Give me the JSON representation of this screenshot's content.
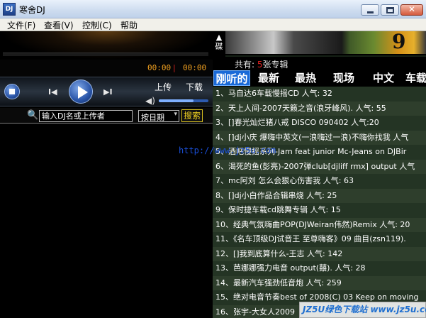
{
  "window": {
    "title": "寒舍DJ",
    "icon_text": "DJ",
    "close_glyph": "✕"
  },
  "menu": [
    {
      "label": "文件(F)"
    },
    {
      "label": "查看(V)"
    },
    {
      "label": "控制(C)"
    },
    {
      "label": "帮助"
    }
  ],
  "player": {
    "time_current": "00:00",
    "time_separator": "|",
    "time_total": "00:00",
    "prev_glyph": "I◀",
    "next_glyph": "▶I",
    "volume_glyph": "◀)",
    "volume_level": 0.7,
    "upload_label": "上传",
    "download_label": "下载"
  },
  "search": {
    "placeholder": "输入DJ名或上传者",
    "sort_value": "按日期",
    "sort_arrow": "▾",
    "button_label": "搜索",
    "search_glyph": "🔍"
  },
  "watermark_url": "http://www.jz5u.com",
  "sidebar_strip_label": "▲\n碟",
  "album": {
    "number": "9",
    "count_prefix": "共有:",
    "count_dot": "5",
    "count_text": "张专辑"
  },
  "tabs": [
    {
      "label": "刚听的",
      "active": true
    },
    {
      "label": "最新",
      "active": false
    },
    {
      "label": "最热",
      "active": false
    },
    {
      "label": "现场",
      "active": false
    },
    {
      "label": "中文",
      "active": false
    },
    {
      "label": "车载",
      "active": false
    }
  ],
  "songs": [
    "1、马自达6车载慢摇CD 人气: 32",
    "2、天上人间-2007天籁之音(浪牙峰风). 人气: 55",
    "3、[]春光灿烂猪八戒 DISCO 090402 人气:20",
    "4、[]dj小庆 爆嗨中英文(一浪嗨过一浪)不嗨你找我 人气",
    "5、酒吧慢摇系列-Jam feat junior Mc-Jeans on DJBir",
    "6、渴死的鱼(彭亮)-2007弹club[djliff rmx] output 人气",
    "7、mc阿刘 怎么会狠心伤害我 人气: 63",
    "8、[]dj小白作品合辑串烧 人气: 25",
    "9、保时捷车载cd跳舞专辑 人气: 15",
    "10、经典气氛嗨曲POP(DJWeiran伟然)Remix 人气: 20",
    "11、《名车顶级DJ试音王 至尊嗨客》09 曲目(zsn119).",
    "12、[]我到底算什么-王志 人气: 142",
    "13、芭娜娜强力电音 output(囍). 人气: 28",
    "14、最新汽车强劲低音炮 人气: 259",
    "15、绝对电音节奏best of 2008(C) 03 Keep on moving",
    "16、张宇-大女人2009"
  ],
  "corner_watermark": "JZ5U绿色下载站 www.jz5u.com"
}
